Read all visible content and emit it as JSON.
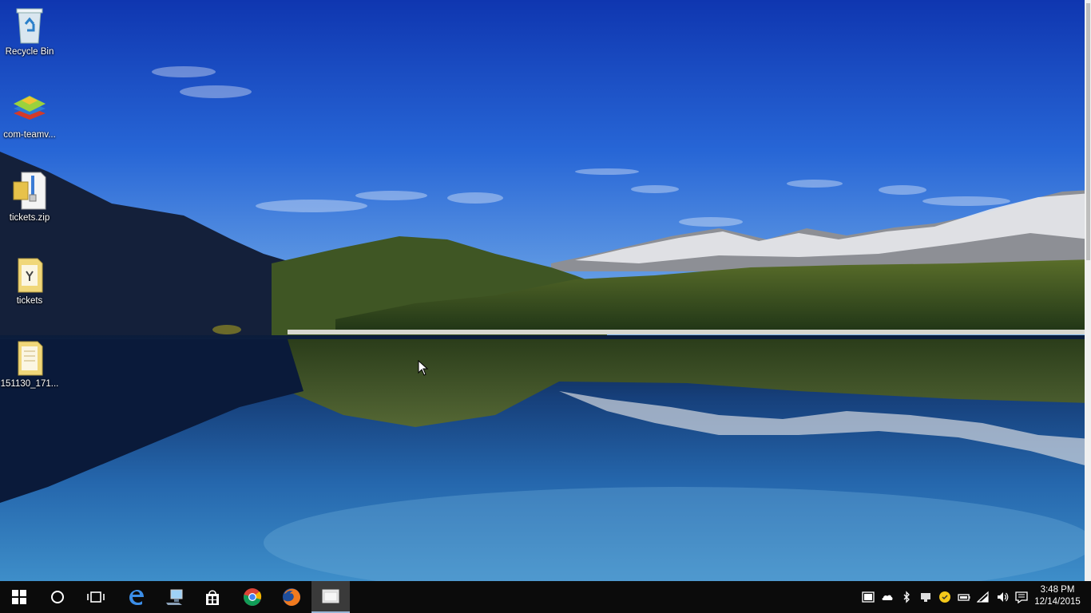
{
  "desktop": {
    "icons": [
      {
        "label": "Recycle Bin",
        "icon": "recycle-bin-icon"
      },
      {
        "label": "com-teamv...",
        "icon": "app-stack-icon"
      },
      {
        "label": "tickets.zip",
        "icon": "zip-folder-icon"
      },
      {
        "label": "tickets",
        "icon": "folder-icon"
      },
      {
        "label": "151130_171...",
        "icon": "folder-icon"
      }
    ]
  },
  "taskbar": {
    "pinned": [
      "start-icon",
      "cortana-icon",
      "task-view-icon",
      "edge-icon",
      "computer-icon",
      "store-icon",
      "chrome-icon",
      "firefox-icon",
      "file-explorer-icon"
    ],
    "tray": [
      "battery-icon",
      "onedrive-icon",
      "bluetooth-icon",
      "network-monitor-icon",
      "norton-icon",
      "power-icon",
      "wifi-icon",
      "volume-icon",
      "action-center-icon"
    ],
    "time": "3:48 PM",
    "date": "12/14/2015"
  },
  "colors": {
    "taskbar_bg": "#0b0b0b",
    "sky_top": "#1440b8",
    "lake": "#1f5fa6"
  }
}
